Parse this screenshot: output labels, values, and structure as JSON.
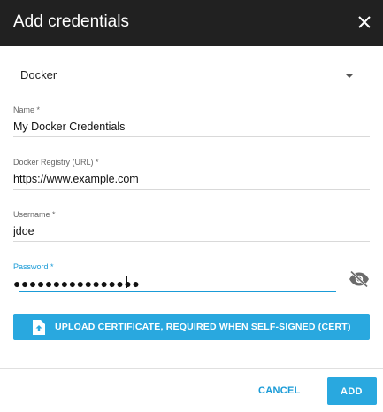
{
  "dialog": {
    "title": "Add credentials",
    "close_icon": "close-icon"
  },
  "type_select": {
    "value": "Docker",
    "icon": "dropdown-caret-icon"
  },
  "fields": {
    "name": {
      "label": "Name *",
      "value": "My Docker Credentials"
    },
    "registry": {
      "label": "Docker Registry (URL) *",
      "value": "https://www.example.com"
    },
    "username": {
      "label": "Username *",
      "value": "jdoe"
    },
    "password": {
      "label": "Password *",
      "value": "●●●●●●●●●●●●●●●●",
      "toggle_icon": "visibility-off-icon"
    }
  },
  "upload_button": {
    "label": "UPLOAD CERTIFICATE, REQUIRED WHEN SELF-SIGNED (CERT)",
    "icon": "file-upload-icon"
  },
  "actions": {
    "cancel_label": "CANCEL",
    "add_label": "ADD"
  },
  "colors": {
    "header_bg": "#212121",
    "accent": "#29a8df",
    "focus": "#1a9bd7"
  }
}
